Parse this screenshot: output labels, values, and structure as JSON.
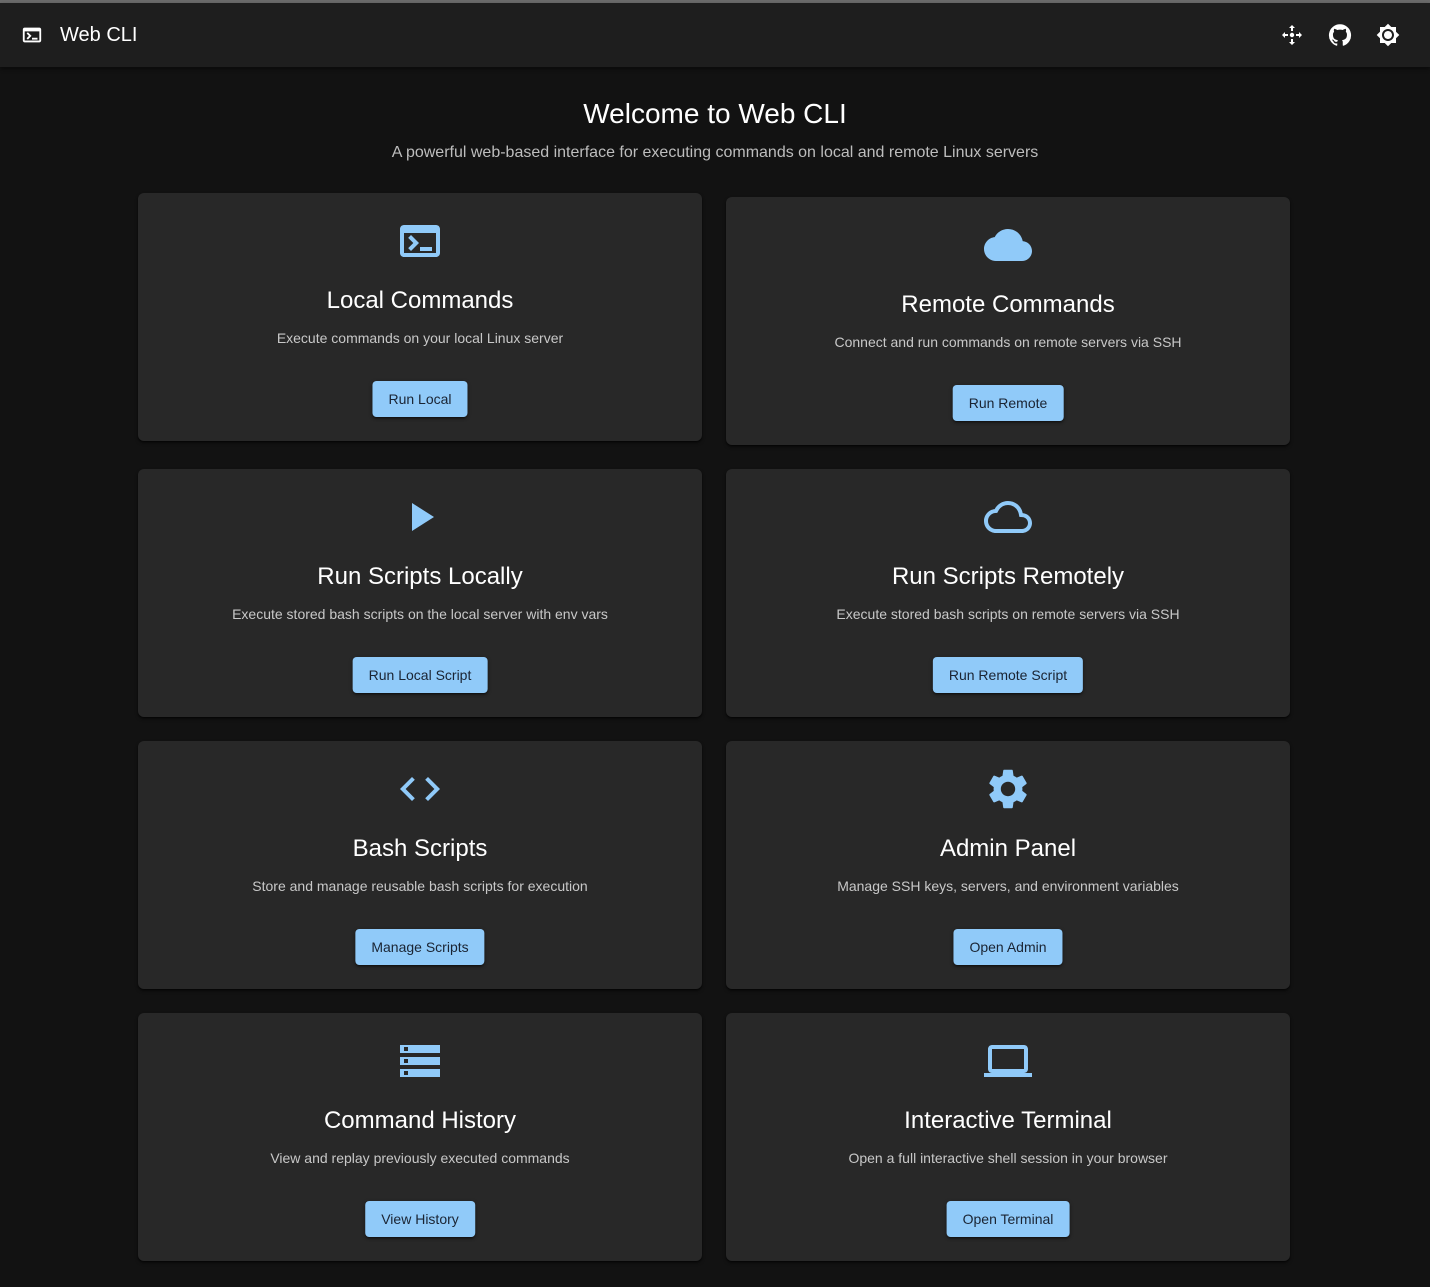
{
  "app_bar": {
    "title": "Web CLI",
    "logo_icon": "terminal-icon",
    "actions": [
      {
        "name": "move-icon-button",
        "icon": "arrows-move-icon"
      },
      {
        "name": "github-icon-button",
        "icon": "github-icon"
      },
      {
        "name": "theme-toggle-button",
        "icon": "brightness-icon"
      }
    ]
  },
  "hero": {
    "title": "Welcome to Web CLI",
    "subtitle": "A powerful web-based interface for executing commands on local and remote Linux servers"
  },
  "cards": [
    {
      "icon": "terminal-icon",
      "title": "Local Commands",
      "description": "Execute commands on your local Linux server",
      "button": "Run Local"
    },
    {
      "icon": "cloud-icon",
      "title": "Remote Commands",
      "description": "Connect and run commands on remote servers via SSH",
      "button": "Run Remote"
    },
    {
      "icon": "play-icon",
      "title": "Run Scripts Locally",
      "description": "Execute stored bash scripts on the local server with env vars",
      "button": "Run Local Script"
    },
    {
      "icon": "cloud-outline-icon",
      "title": "Run Scripts Remotely",
      "description": "Execute stored bash scripts on remote servers via SSH",
      "button": "Run Remote Script"
    },
    {
      "icon": "code-icon",
      "title": "Bash Scripts",
      "description": "Store and manage reusable bash scripts for execution",
      "button": "Manage Scripts"
    },
    {
      "icon": "gear-icon",
      "title": "Admin Panel",
      "description": "Manage SSH keys, servers, and environment variables",
      "button": "Open Admin"
    },
    {
      "icon": "storage-list-icon",
      "title": "Command History",
      "description": "View and replay previously executed commands",
      "button": "View History"
    },
    {
      "icon": "laptop-icon",
      "title": "Interactive Terminal",
      "description": "Open a full interactive shell session in your browser",
      "button": "Open Terminal"
    }
  ],
  "colors": {
    "background": "#121212",
    "app_bar": "#1e1e1e",
    "card": "#282828",
    "accent": "#90caf9"
  }
}
